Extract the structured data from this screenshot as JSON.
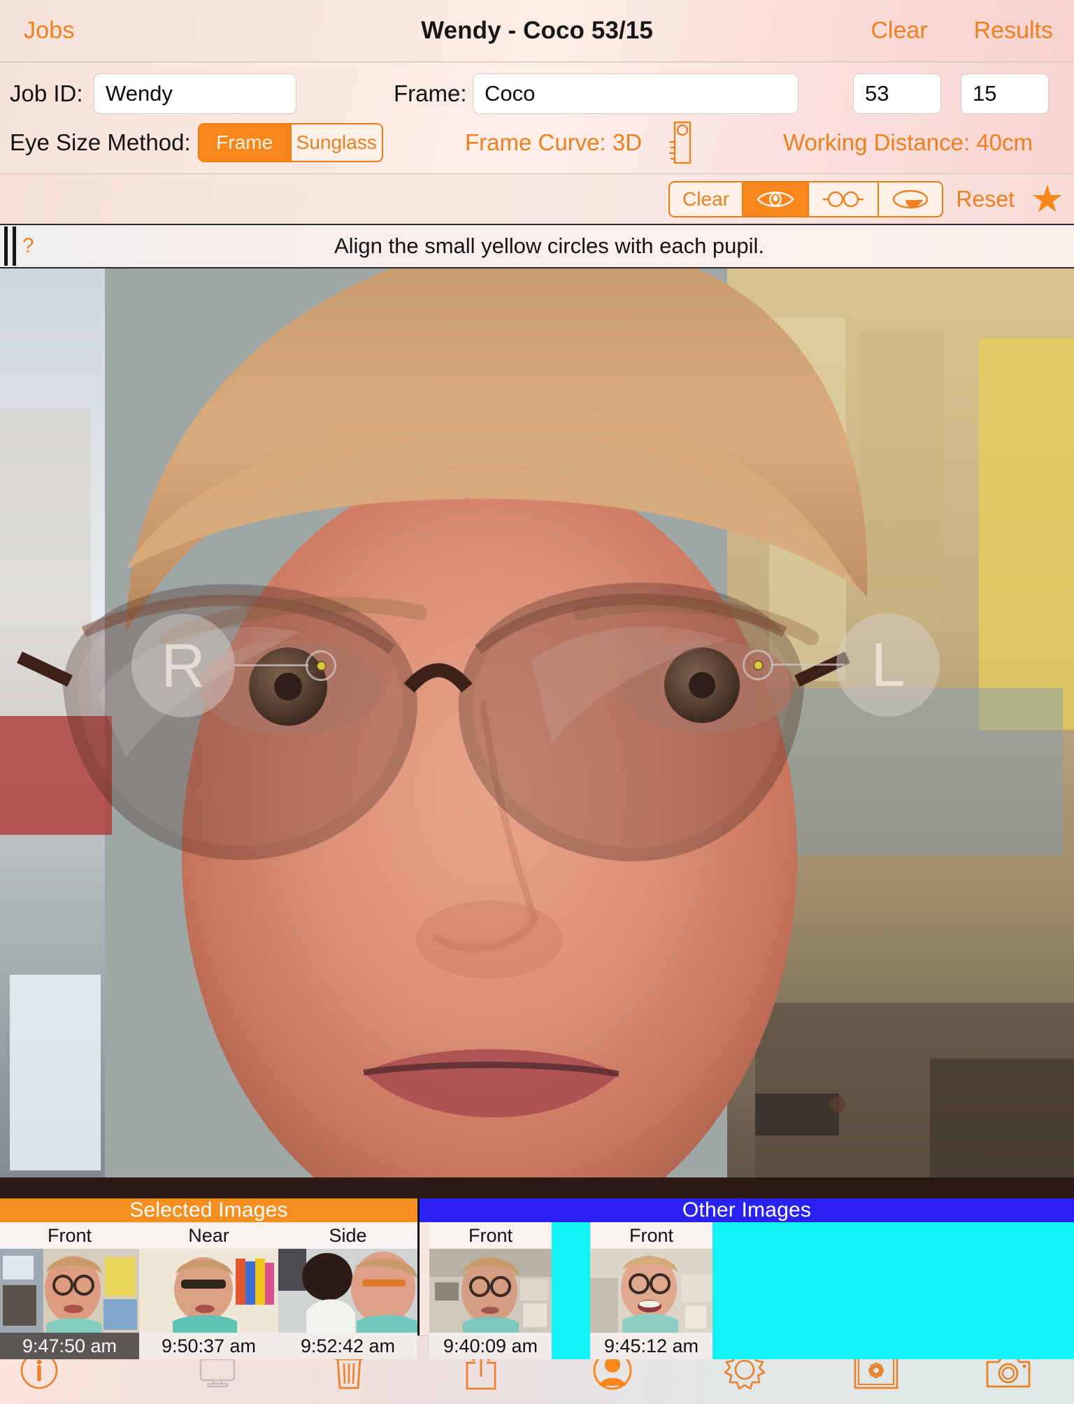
{
  "navbar": {
    "back_label": "Jobs",
    "title": "Wendy - Coco 53/15",
    "clear_label": "Clear",
    "results_label": "Results"
  },
  "job_panel": {
    "job_id_label": "Job ID:",
    "job_id_value": "Wendy",
    "frame_label": "Frame:",
    "frame_value": "Coco",
    "frame_a_value": "53",
    "frame_b_value": "15",
    "eye_size_method_label": "Eye Size Method:",
    "eye_size_options": [
      "Frame",
      "Sunglass"
    ],
    "eye_size_selected": "Frame",
    "frame_curve_label": "Frame Curve: 3D",
    "working_distance_label": "Working Distance: 40cm",
    "ruler_icon": "ruler-icon"
  },
  "toolbar": {
    "clear_label": "Clear",
    "modes": [
      {
        "name": "eye-icon",
        "selected": true
      },
      {
        "name": "glasses-icon",
        "selected": false
      },
      {
        "name": "lens-icon",
        "selected": false
      }
    ],
    "reset_label": "Reset",
    "star_glyph": "★"
  },
  "instruction_bar": {
    "help_glyph": "?",
    "text": "Align the small yellow circles with each pupil."
  },
  "photo_overlay": {
    "right_marker_label": "R",
    "left_marker_label": "L",
    "pupil_marker_color": "#d9c840"
  },
  "thumbnails": {
    "selected_group_label": "Selected Images",
    "other_group_label": "Other Images",
    "selected": [
      {
        "caption": "Front",
        "time": "9:47:50 am",
        "active": true
      },
      {
        "caption": "Near",
        "time": "9:50:37 am",
        "active": false
      },
      {
        "caption": "Side",
        "time": "9:52:42 am",
        "active": false
      }
    ],
    "other": [
      {
        "caption": "Front",
        "time": "9:40:09 am",
        "active": false
      },
      {
        "caption": "Front",
        "time": "9:45:12 am",
        "active": false
      }
    ]
  },
  "bottom_bar": {
    "items": [
      {
        "name": "info-icon",
        "enabled": true
      },
      {
        "name": "display-icon",
        "enabled": false
      },
      {
        "name": "trash-icon",
        "enabled": true
      },
      {
        "name": "share-icon",
        "enabled": true
      },
      {
        "name": "person-icon",
        "enabled": true
      },
      {
        "name": "gear-icon",
        "enabled": true
      },
      {
        "name": "photo-library-icon",
        "enabled": true
      },
      {
        "name": "camera-icon",
        "enabled": true
      }
    ]
  },
  "colors": {
    "accent_orange": "#ee8021",
    "accent_orange_fill": "#f7871b",
    "selected_header": "#f59020",
    "other_header": "#2a22f2",
    "cyan": "#13f2f4"
  }
}
